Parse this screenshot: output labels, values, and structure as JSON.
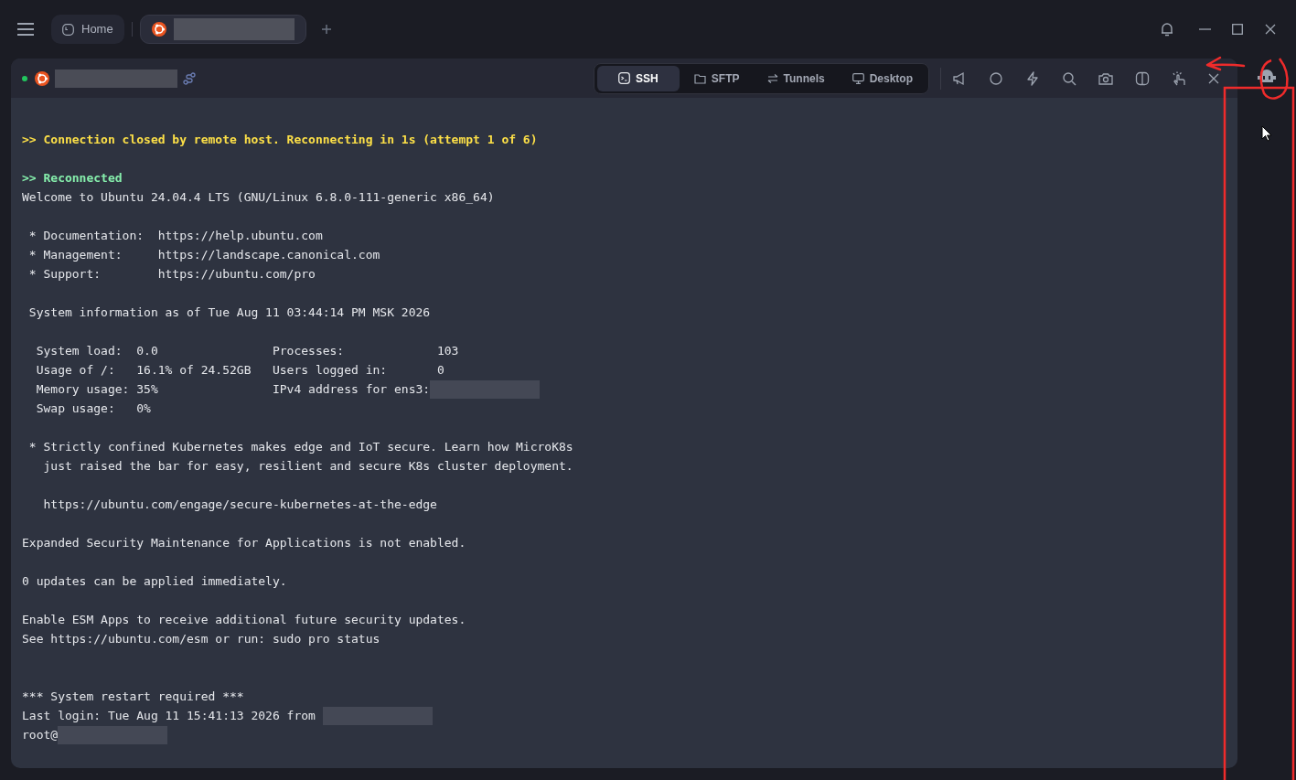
{
  "top_tabs": [
    {
      "kind": "home",
      "label": "Home",
      "selected": false
    },
    {
      "kind": "host",
      "redacted": true,
      "selected": true
    }
  ],
  "session": {
    "color": "#22c55e",
    "redacted": true
  },
  "mode_tabs": [
    {
      "kind": "ssh",
      "label": "SSH",
      "selected": true
    },
    {
      "kind": "sftp",
      "label": "SFTP",
      "selected": false
    },
    {
      "kind": "tunnels",
      "label": "Tunnels",
      "selected": false
    },
    {
      "kind": "desktop",
      "label": "Desktop",
      "selected": false
    }
  ],
  "terminal": {
    "lines": [
      {
        "kind": "warning",
        "text": ">> Connection closed by remote host. Reconnecting in 1s (attempt 1 of 6)"
      },
      {
        "kind": "blank"
      },
      {
        "kind": "success",
        "text": ">> Reconnected"
      },
      {
        "kind": "normal",
        "text": "Welcome to Ubuntu 24.04.4 LTS (GNU/Linux 6.8.0-111-generic x86_64)"
      },
      {
        "kind": "blank"
      },
      {
        "kind": "normal",
        "text": " * Documentation:  https://help.ubuntu.com"
      },
      {
        "kind": "normal",
        "text": " * Management:     https://landscape.canonical.com"
      },
      {
        "kind": "normal",
        "text": " * Support:        https://ubuntu.com/pro"
      },
      {
        "kind": "blank"
      },
      {
        "kind": "normal",
        "text": " System information as of Tue Aug 11 03:44:14 PM MSK 2026"
      },
      {
        "kind": "blank"
      },
      {
        "kind": "normal",
        "text": "  System load:  0.0                Processes:             103"
      },
      {
        "kind": "normal",
        "text": "  Usage of /:   16.1% of 24.52GB   Users logged in:       0"
      },
      {
        "kind": "normal",
        "text": "  Memory usage: 35%                IPv4 address for ens3:",
        "redacted": true
      },
      {
        "kind": "normal",
        "text": "  Swap usage:   0%"
      },
      {
        "kind": "blank"
      },
      {
        "kind": "normal",
        "text": " * Strictly confined Kubernetes makes edge and IoT secure. Learn how MicroK8s"
      },
      {
        "kind": "normal",
        "text": "   just raised the bar for easy, resilient and secure K8s cluster deployment."
      },
      {
        "kind": "blank"
      },
      {
        "kind": "normal",
        "text": "   https://ubuntu.com/engage/secure-kubernetes-at-the-edge"
      },
      {
        "kind": "blank"
      },
      {
        "kind": "normal",
        "text": "Expanded Security Maintenance for Applications is not enabled."
      },
      {
        "kind": "blank"
      },
      {
        "kind": "normal",
        "text": "0 updates can be applied immediately."
      },
      {
        "kind": "blank"
      },
      {
        "kind": "normal",
        "text": "Enable ESM Apps to receive additional future security updates."
      },
      {
        "kind": "normal",
        "text": "See https://ubuntu.com/esm or run: sudo pro status"
      },
      {
        "kind": "blank"
      },
      {
        "kind": "blank"
      },
      {
        "kind": "normal",
        "text": "*** System restart required ***"
      },
      {
        "kind": "normal",
        "text": "Last login: Tue Aug 11 15:41:13 2026 from ",
        "redacted": true
      },
      {
        "kind": "normal",
        "text": "root@",
        "redacted": true
      }
    ]
  }
}
